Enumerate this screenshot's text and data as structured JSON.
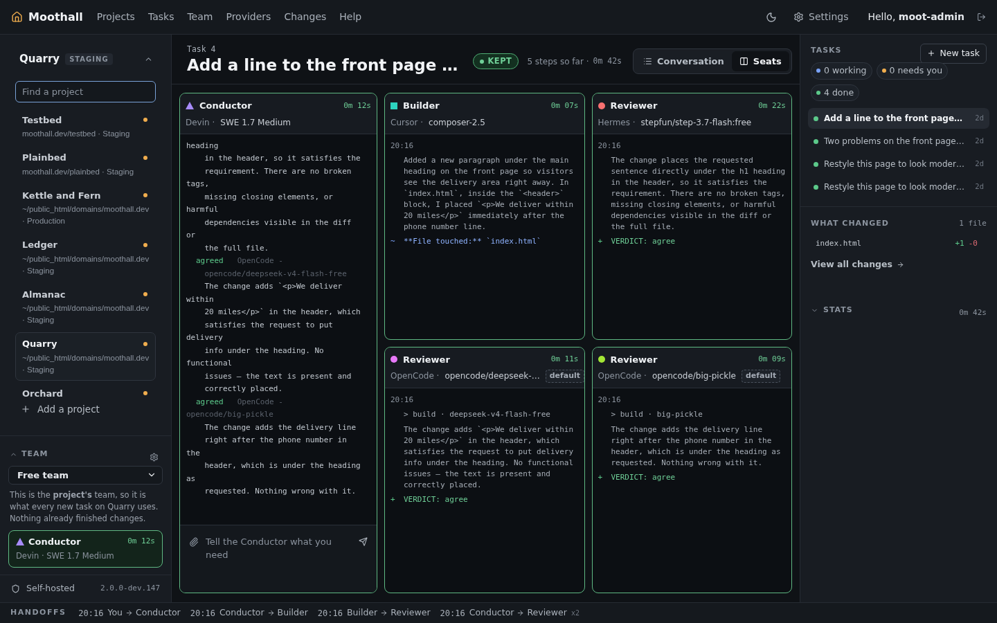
{
  "nav": {
    "brand": "Moothall",
    "items": [
      "Projects",
      "Tasks",
      "Team",
      "Providers",
      "Changes",
      "Help"
    ],
    "settings": "Settings",
    "greeting": "Hello, **moot-admin**"
  },
  "sidebar": {
    "project": "Quarry",
    "env_badge": "STAGING",
    "search": {
      "placeholder": "Find a project"
    },
    "projects": [
      {
        "name": "Testbed",
        "detail": "moothall.dev/testbed · Staging",
        "color": "#f0ad4e",
        "selected": false
      },
      {
        "name": "Plainbed",
        "detail": "moothall.dev/plainbed · Staging",
        "color": "#f0ad4e",
        "selected": false
      },
      {
        "name": "Kettle and Fern",
        "detail": "~/public_html/domains/moothall.dev · Production",
        "color": "#f0ad4e",
        "selected": false
      },
      {
        "name": "Ledger",
        "detail": "~/public_html/domains/moothall.dev · Staging",
        "color": "#f0ad4e",
        "selected": false
      },
      {
        "name": "Almanac",
        "detail": "~/public_html/domains/moothall.dev · Staging",
        "color": "#f0ad4e",
        "selected": false
      },
      {
        "name": "Quarry",
        "detail": "~/public_html/domains/moothall.dev · Staging",
        "color": "#f0ad4e",
        "selected": true
      },
      {
        "name": "Orchard",
        "color": "#f0ad4e",
        "selected": false
      }
    ],
    "add_project": "Add a project",
    "team": {
      "title": "TEAM",
      "expanded": true,
      "select": "Free team",
      "note": "This is the **project's** team, so it is what every new task on Quarry uses. Nothing already finished changes.",
      "seat": {
        "role": "Conductor",
        "time": "0m 12s",
        "detail": "Devin · SWE 1.7 Medium",
        "kind": "triangle",
        "color": "#a78bfa"
      }
    },
    "footer": {
      "label": "Self-hosted",
      "version": "2.0.0-dev.147"
    }
  },
  "task": {
    "number": "Task 4",
    "title": "Add a line to the front page …",
    "status": "KEPT",
    "steps": "5 steps so far ·",
    "elapsed": "0m 42s",
    "views": [
      {
        "label": "Conversation",
        "selected": false
      },
      {
        "label": "Seats",
        "selected": true
      }
    ]
  },
  "conductor": {
    "role": "Conductor",
    "time": "0m 12s",
    "provider": "Devin ·",
    "model": "SWE 1.7 Medium",
    "kind": "triangle",
    "color": "#a78bfa",
    "log": [
      {
        "kind": "text",
        "text": "heading"
      },
      {
        "kind": "text",
        "text": "    in the header, so it satisfies the"
      },
      {
        "kind": "text",
        "text": "    requirement. There are no broken"
      },
      {
        "kind": "text",
        "text": "tags,"
      },
      {
        "kind": "text",
        "text": "    missing closing elements, or"
      },
      {
        "kind": "text",
        "text": "harmful"
      },
      {
        "kind": "text",
        "text": "    dependencies visible in the diff"
      },
      {
        "kind": "text",
        "text": "or"
      },
      {
        "kind": "text",
        "text": "    the full file."
      },
      {
        "kind": "agreed",
        "label": "agreed",
        "source": "OpenCode -"
      },
      {
        "kind": "source",
        "text": "    opencode/deepseek-v4-flash-free"
      },
      {
        "kind": "text",
        "text": "    The change adds `<p>We deliver"
      },
      {
        "kind": "text",
        "text": "within"
      },
      {
        "kind": "text",
        "text": "    20 miles</p>` in the header, which"
      },
      {
        "kind": "text",
        "text": "    satisfies the request to put"
      },
      {
        "kind": "text",
        "text": "delivery"
      },
      {
        "kind": "text",
        "text": "    info under the heading. No"
      },
      {
        "kind": "text",
        "text": "functional"
      },
      {
        "kind": "text",
        "text": "    issues — the text is present and"
      },
      {
        "kind": "text",
        "text": "    correctly placed."
      },
      {
        "kind": "agreed",
        "label": "agreed",
        "source": "OpenCode -"
      },
      {
        "kind": "source",
        "text": "opencode/big-pickle"
      },
      {
        "kind": "text",
        "text": "    The change adds the delivery line"
      },
      {
        "kind": "text",
        "text": "    right after the phone number in"
      },
      {
        "kind": "text",
        "text": "the"
      },
      {
        "kind": "text",
        "text": "    header, which is under the heading"
      },
      {
        "kind": "text",
        "text": "as"
      },
      {
        "kind": "text",
        "text": "    requested. Nothing wrong with it."
      }
    ],
    "input": {
      "placeholder": "Tell the Conductor what you need"
    }
  },
  "seats": [
    {
      "role": "Builder",
      "time": "0m 07s",
      "provider": "Cursor ·",
      "model": "composer-2.5",
      "kind": "square",
      "color": "#2dd4bf",
      "stamp": "20:16",
      "entries": [
        {
          "kind": "text",
          "text": "Added a new paragraph under the main heading on the front page so visitors see the delivery area right away. In `index.html`, inside the `<header>` block, I placed `<p>We deliver within 20 miles</p>` immediately after the phone number line."
        },
        {
          "kind": "file",
          "mark": "~",
          "text": "**File touched:** `index.html`"
        }
      ]
    },
    {
      "role": "Reviewer",
      "time": "0m 22s",
      "provider": "Hermes ·",
      "model": "stepfun/step-3.7-flash:free",
      "kind": "circle",
      "color": "#f87171",
      "stamp": "20:16",
      "entries": [
        {
          "kind": "text",
          "text": "The change places the requested sentence directly under the h1 heading in the header, so it satisfies the requirement. There are no broken tags, missing closing elements, or harmful dependencies visible in the diff or the full file."
        },
        {
          "kind": "verdict",
          "mark": "+",
          "text": "VERDICT: agree"
        }
      ]
    },
    {
      "role": "Reviewer",
      "time": "0m 11s",
      "provider": "OpenCode ·",
      "model": "opencode/deepseek-…",
      "badge": "default",
      "kind": "circle",
      "color": "#e879f9",
      "stamp": "20:16",
      "entries": [
        {
          "kind": "command",
          "text": "> build · deepseek-v4-flash-free"
        },
        {
          "kind": "text",
          "text": "The change adds `<p>We deliver within 20 miles</p>` in the header, which satisfies the request to put delivery info under the heading. No functional issues — the text is present and correctly placed."
        },
        {
          "kind": "verdict",
          "mark": "+",
          "text": "VERDICT: agree"
        }
      ]
    },
    {
      "role": "Reviewer",
      "time": "0m 09s",
      "provider": "OpenCode ·",
      "model": "opencode/big-pickle",
      "badge": "default",
      "kind": "circle",
      "color": "#a3e635",
      "stamp": "20:16",
      "entries": [
        {
          "kind": "command",
          "text": "> build · big-pickle"
        },
        {
          "kind": "text",
          "text": "The change adds the delivery line right after the phone number in the header, which is under the heading as requested. Nothing wrong with it."
        },
        {
          "kind": "verdict",
          "mark": "+",
          "text": "VERDICT: agree"
        }
      ]
    }
  ],
  "tasks_panel": {
    "title": "TASKS",
    "new_task": "New task",
    "filters": [
      {
        "label": "0 working",
        "color": "#7aa2f7"
      },
      {
        "label": "0 needs you",
        "color": "#f0ad4e"
      },
      {
        "label": "4 done",
        "color": "#5cc98a"
      }
    ],
    "tasks": [
      {
        "title": "Add a line to the front page…",
        "age": "2d",
        "color": "#5cc98a",
        "selected": true
      },
      {
        "title": "Two problems on the front page…",
        "age": "2d",
        "color": "#5cc98a",
        "selected": false
      },
      {
        "title": "Restyle this page to look moder…",
        "age": "2d",
        "color": "#5cc98a",
        "selected": false
      },
      {
        "title": "Restyle this page to look moder…",
        "age": "2d",
        "color": "#5cc98a",
        "selected": false
      }
    ],
    "changes": {
      "title": "WHAT CHANGED",
      "count": "1 file",
      "files": [
        {
          "name": "index.html",
          "added": "+1",
          "removed": "-0"
        }
      ],
      "link": "View all changes"
    },
    "stats": {
      "title": "STATS",
      "expanded": false,
      "value": "0m 42s"
    }
  },
  "handoffs": {
    "title": "HANDOFFS",
    "items": [
      {
        "time": "20:16",
        "from": "You",
        "to": "Conductor"
      },
      {
        "time": "20:16",
        "from": "Conductor",
        "to": "Builder"
      },
      {
        "time": "20:16",
        "from": "Builder",
        "to": "Reviewer"
      },
      {
        "time": "20:16",
        "from": "Conductor",
        "to": "Reviewer",
        "count": "x2"
      }
    ]
  }
}
